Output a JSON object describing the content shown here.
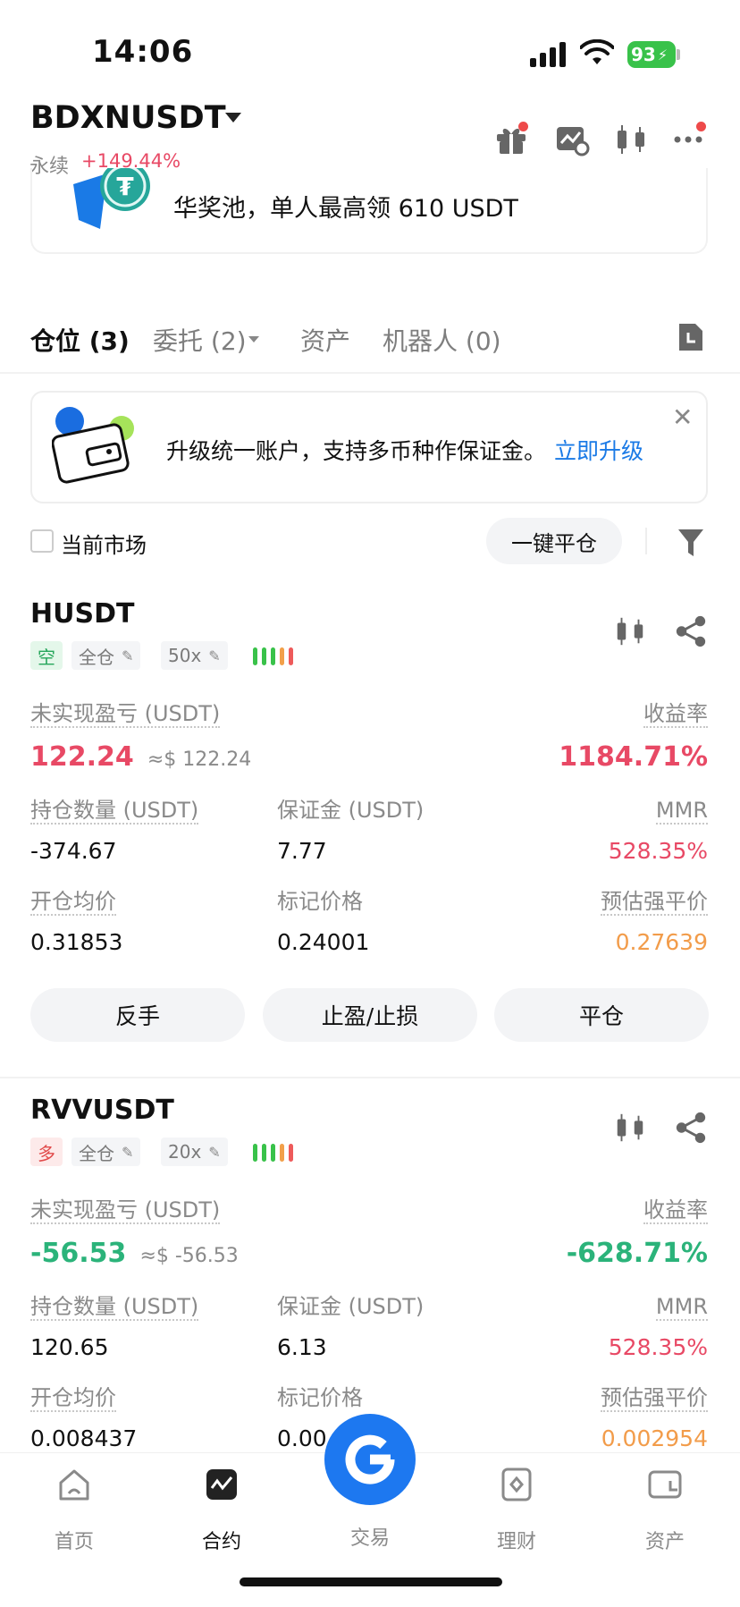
{
  "status_bar": {
    "time": "14:06",
    "battery": "93"
  },
  "header": {
    "pair": "BDXNUSDT",
    "perp_label": "永续",
    "change": "+149.44%"
  },
  "banner": {
    "text": "华奖池，单人最高领 610 USDT"
  },
  "tabs": [
    {
      "label": "仓位 (3)",
      "active": true
    },
    {
      "label": "委托 (2)"
    },
    {
      "label": "资产"
    },
    {
      "label": "机器人 (0)"
    }
  ],
  "upgrade": {
    "text": "升级统一账户，支持多币种作保证金。",
    "link": "立即升级",
    "close": "✕"
  },
  "filter": {
    "current_market": "当前市场",
    "close_all": "一键平仓"
  },
  "labels": {
    "unrealized_pnl": "未实现盈亏 (USDT)",
    "roe": "收益率",
    "size": "持仓数量 (USDT)",
    "margin": "保证金 (USDT)",
    "mmr": "MMR",
    "entry_price": "开仓均价",
    "mark_price": "标记价格",
    "liq_price": "预估强平价"
  },
  "positions": [
    {
      "symbol": "HUSDT",
      "side": "空",
      "margin_mode": "全仓",
      "leverage": "50x",
      "pnl": "122.24",
      "pnl_usd": "≈$ 122.24",
      "roe": "1184.71%",
      "size": "-374.67",
      "margin": "7.77",
      "mmr": "528.35%",
      "entry_price": "0.31853",
      "mark_price": "0.24001",
      "liq_price": "0.27639",
      "buttons": [
        "反手",
        "止盈/止损",
        "平仓"
      ]
    },
    {
      "symbol": "RVVUSDT",
      "side": "多",
      "margin_mode": "全仓",
      "leverage": "20x",
      "pnl": "-56.53",
      "pnl_usd": "≈$ -56.53",
      "roe": "-628.71%",
      "size": "120.65",
      "margin": "6.13",
      "mmr": "528.35%",
      "entry_price": "0.008437",
      "mark_price": "0.00",
      "liq_price": "0.002954"
    }
  ],
  "nav": [
    {
      "label": "首页",
      "icon": "home-icon"
    },
    {
      "label": "合约",
      "icon": "futures-icon",
      "active": true
    },
    {
      "label": "交易",
      "icon": "trade-icon"
    },
    {
      "label": "理财",
      "icon": "earn-icon"
    },
    {
      "label": "资产",
      "icon": "wallet-icon"
    }
  ],
  "colors": {
    "red": "#e84965",
    "green": "#2bb37a",
    "orange": "#f29c4a",
    "link_blue": "#1a7ae6",
    "fab_blue": "#1d78f0"
  }
}
